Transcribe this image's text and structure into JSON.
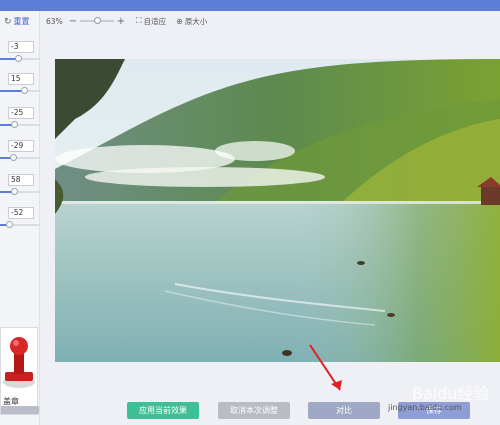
{
  "left_panel": {
    "reset_label": "重置",
    "adjustments": [
      {
        "value": "-3",
        "fraction": 0.45
      },
      {
        "value": "15",
        "fraction": 0.6
      },
      {
        "value": "-25",
        "fraction": 0.35
      },
      {
        "value": "-29",
        "fraction": 0.33
      },
      {
        "value": "58",
        "fraction": 0.34
      },
      {
        "value": "-52",
        "fraction": 0.22
      }
    ],
    "stamp_label": "盖章"
  },
  "toolbar": {
    "zoom": "63%",
    "zoom_minus": "−",
    "zoom_plus": "+",
    "fit_label": "自适应",
    "original_label": "原大小"
  },
  "buttons": {
    "apply": "应用当前效果",
    "cancel": "取消本次调整",
    "compare": "对比",
    "save": "保存"
  },
  "watermark": {
    "title": "Baidu经验",
    "url": "jingyan.baidu.com"
  },
  "icons": {
    "reset": "reset-icon",
    "fit": "fit-screen-icon",
    "original": "zoom-icon",
    "annotation": "red-arrow-icon"
  }
}
